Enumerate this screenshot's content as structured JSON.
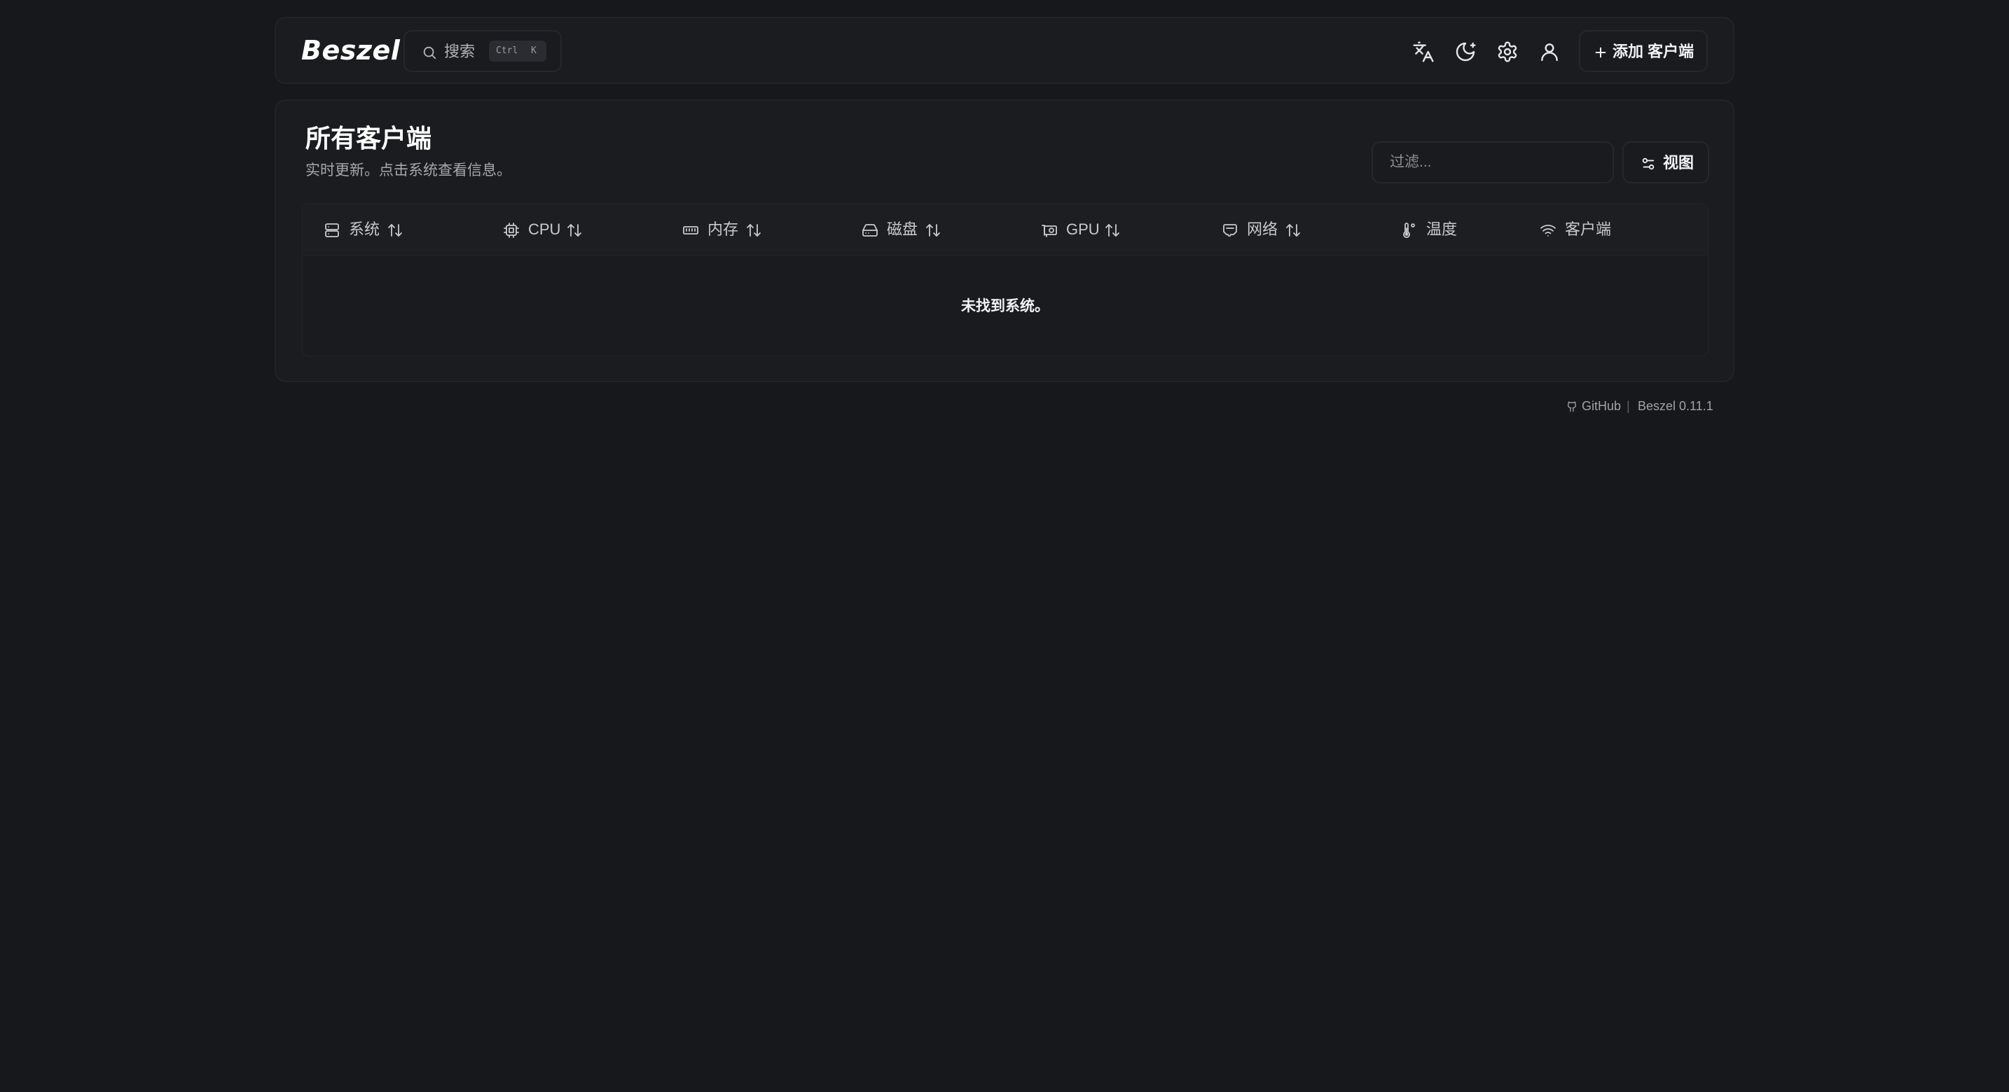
{
  "header": {
    "logo": "Beszel",
    "search": {
      "label": "搜索",
      "shortcut_ctrl": "Ctrl",
      "shortcut_key": "K"
    },
    "icons": [
      "translate-icon",
      "moon-icon",
      "gear-icon",
      "user-icon"
    ],
    "add_button_label": "添加 客户端"
  },
  "main": {
    "title": "所有客户端",
    "subtitle": "实时更新。点击系统查看信息。",
    "filter_placeholder": "过滤...",
    "view_button_label": "视图"
  },
  "table": {
    "columns": [
      {
        "label": "系统",
        "icon": "server-icon",
        "sortable": true
      },
      {
        "label": "CPU",
        "icon": "cpu-icon",
        "sortable": true
      },
      {
        "label": "内存",
        "icon": "memory-icon",
        "sortable": true
      },
      {
        "label": "磁盘",
        "icon": "disk-icon",
        "sortable": true
      },
      {
        "label": "GPU",
        "icon": "gpu-icon",
        "sortable": true
      },
      {
        "label": "网络",
        "icon": "network-icon",
        "sortable": true
      },
      {
        "label": "温度",
        "icon": "thermometer-icon",
        "sortable": false
      },
      {
        "label": "客户端",
        "icon": "wifi-icon",
        "sortable": false
      }
    ],
    "empty_message": "未找到系统。"
  },
  "footer": {
    "github_label": "GitHub",
    "separator": "|",
    "version_label": "Beszel 0.11.1"
  },
  "colors": {
    "background": "#17181b",
    "panel": "#1b1c1f",
    "border": "#222327",
    "text_primary": "#ffffff",
    "text_muted": "#a7a8ae"
  }
}
